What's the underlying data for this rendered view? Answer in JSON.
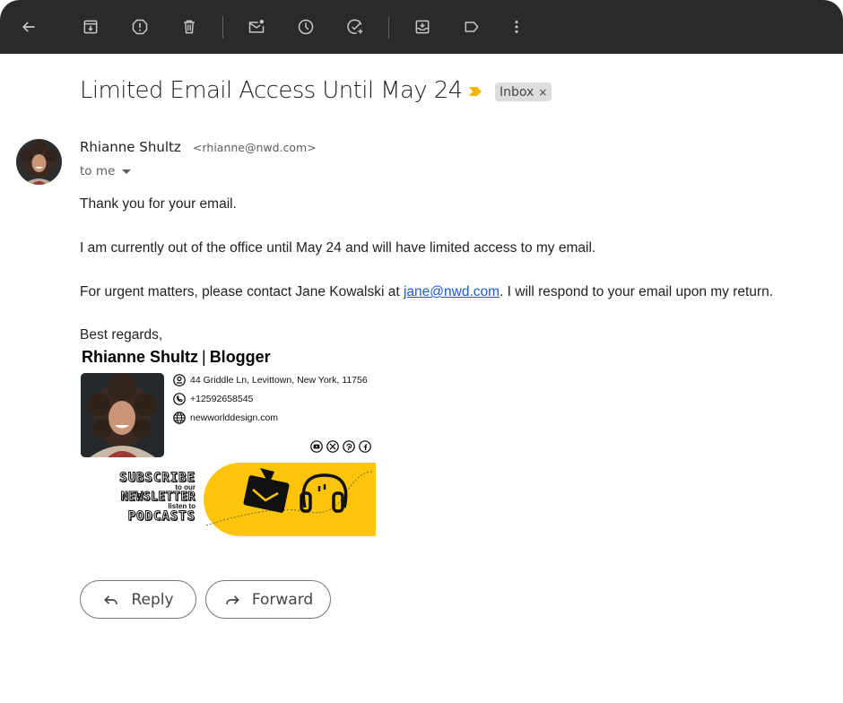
{
  "toolbar": {
    "buttons": [
      {
        "name": "back",
        "icon": "arrow-left-icon"
      },
      {
        "name": "archive",
        "icon": "archive-icon"
      },
      {
        "name": "report-spam",
        "icon": "report-icon"
      },
      {
        "name": "delete",
        "icon": "trash-icon"
      },
      {
        "name": "mark-unread",
        "icon": "mark-unread-icon"
      },
      {
        "name": "snooze",
        "icon": "clock-icon"
      },
      {
        "name": "add-to-tasks",
        "icon": "add-task-icon"
      },
      {
        "name": "move-to",
        "icon": "move-to-inbox-icon"
      },
      {
        "name": "labels",
        "icon": "label-icon"
      },
      {
        "name": "more",
        "icon": "more-vert-icon"
      }
    ]
  },
  "email": {
    "subject": "Limited Email Access Until May 24",
    "label": "Inbox",
    "label_remove": "×",
    "sender_name": "Rhianne Shultz",
    "sender_email": "<rhianne@nwd.com>",
    "recipient": "to me",
    "body": {
      "line1": "Thank you for your email.",
      "line2": "I am currently out of the office until May 24 and will have limited access to my email.",
      "line3_pre": "For urgent matters, please contact Jane Kowalski at ",
      "line3_link": "jane@nwd.com",
      "line3_post": ". I will respond to your email upon my return.",
      "closing": "Best regards,"
    },
    "signature": {
      "name": "Rhianne Shultz",
      "separator": "|",
      "title": "Blogger",
      "address": "44 Griddle Ln, Levittown, New York, 11756",
      "phone": "+12592658545",
      "website": "newworlddesign.com",
      "social": [
        "youtube",
        "x",
        "pinterest",
        "facebook"
      ],
      "banner": {
        "line1": "SUBSCRIBE",
        "line2": "to our",
        "line3": "NEWSLETTER",
        "line4": "listen to",
        "line5": "PODCASTS",
        "accent": "#fcc509"
      }
    }
  },
  "actions": {
    "reply": "Reply",
    "forward": "Forward"
  },
  "colors": {
    "toolbar_bg": "#2a2a2a",
    "link": "#1a5cd0",
    "importance": "#f4b400"
  }
}
